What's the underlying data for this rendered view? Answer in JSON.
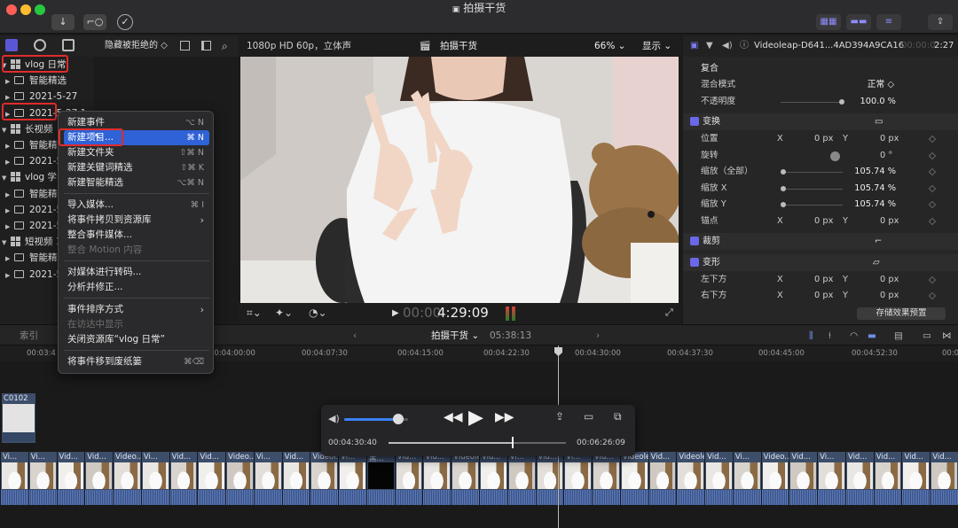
{
  "window": {
    "title": "拍摄干货",
    "traffic_lights": [
      "#ff5f57",
      "#febc2e",
      "#28c840"
    ],
    "toolbar_icons": [
      "import-icon",
      "keyword-icon",
      "check-icon"
    ],
    "right_icons": [
      "library-layout-icon",
      "timeline-layout-icon",
      "inspector-layout-icon",
      "share-icon"
    ]
  },
  "sidebar": {
    "filter_label": "隐藏被拒绝的",
    "items": [
      {
        "label": "vlog 日常",
        "type": "library",
        "expanded": true
      },
      {
        "label": "智能精选",
        "type": "folder",
        "expanded": false
      },
      {
        "label": "2021-5-27",
        "type": "event",
        "expanded": false
      },
      {
        "label": "2021-5-27 1",
        "type": "event",
        "expanded": false
      },
      {
        "label": "长视频",
        "type": "library",
        "expanded": true
      },
      {
        "label": "智能精选",
        "type": "folder",
        "expanded": false
      },
      {
        "label": "2021-5",
        "type": "event",
        "expanded": false
      },
      {
        "label": "vlog 学习",
        "type": "library",
        "expanded": true
      },
      {
        "label": "智能精选",
        "type": "folder",
        "expanded": false
      },
      {
        "label": "2021-5",
        "type": "event",
        "expanded": false
      },
      {
        "label": "2021-5",
        "type": "event",
        "expanded": false
      },
      {
        "label": "短视频 1",
        "type": "library",
        "expanded": true
      },
      {
        "label": "智能精选",
        "type": "folder",
        "expanded": false
      },
      {
        "label": "2021-5",
        "type": "event",
        "expanded": false
      }
    ]
  },
  "context_menu": {
    "items": [
      {
        "label": "新建事件",
        "shortcut": "⌥ N",
        "enabled": true
      },
      {
        "label": "新建项目...",
        "shortcut": "⌘ N",
        "enabled": true,
        "highlighted": true
      },
      {
        "label": "新建文件夹",
        "shortcut": "⇧⌘ N",
        "enabled": true
      },
      {
        "label": "新建关键词精选",
        "shortcut": "⇧⌘ K",
        "enabled": true
      },
      {
        "label": "新建智能精选",
        "shortcut": "⌥⌘ N",
        "enabled": true
      },
      {
        "separator": true
      },
      {
        "label": "导入媒体...",
        "shortcut": "⌘ I",
        "enabled": true
      },
      {
        "label": "将事件拷贝到资源库",
        "shortcut": "",
        "enabled": true,
        "submenu": true
      },
      {
        "label": "整合事件媒体...",
        "shortcut": "",
        "enabled": true
      },
      {
        "label": "整合 Motion 内容",
        "shortcut": "",
        "enabled": false
      },
      {
        "separator": true
      },
      {
        "label": "对媒体进行转码...",
        "shortcut": "",
        "enabled": true
      },
      {
        "label": "分析并修正...",
        "shortcut": "",
        "enabled": true
      },
      {
        "separator": true
      },
      {
        "label": "事件排序方式",
        "shortcut": "",
        "enabled": true,
        "submenu": true
      },
      {
        "label": "在访达中显示",
        "shortcut": "",
        "enabled": false
      },
      {
        "label": "关闭资源库“vlog 日常”",
        "shortcut": "",
        "enabled": true
      },
      {
        "separator": true
      },
      {
        "label": "将事件移到废纸篓",
        "shortcut": "⌘⌫",
        "enabled": true
      }
    ]
  },
  "viewer": {
    "format": "1080p HD 60p，立体声",
    "project_name": "拍摄干货",
    "zoom": "66%",
    "display_menu": "显示",
    "timecode_dim": "00:00",
    "timecode": "4:29:09"
  },
  "inspector": {
    "clip_name": "Videoleap-D641...4AD394A9CA16",
    "duration_dim": "00:00:0",
    "duration": "2:27",
    "sections": {
      "composite": "复合",
      "transform": "变换",
      "crop": "裁剪",
      "distort": "变形"
    },
    "composite_rows": [
      {
        "label": "混合模式",
        "value": "正常 ◇"
      },
      {
        "label": "不透明度",
        "value": "100.0 %"
      }
    ],
    "transform_rows": [
      {
        "label": "位置",
        "x": "0 px",
        "y": "0 px"
      },
      {
        "label": "旋转",
        "value": "0 °"
      },
      {
        "label": "缩放（全部）",
        "value": "105.74 %"
      },
      {
        "label": "缩放 X",
        "value": "105.74 %"
      },
      {
        "label": "缩放 Y",
        "value": "105.74 %"
      },
      {
        "label": "锚点",
        "x": "0 px",
        "y": "0 px"
      }
    ],
    "distort_rows": [
      {
        "label": "左下方",
        "x": "0 px",
        "y": "0 px"
      },
      {
        "label": "右下方",
        "x": "0 px",
        "y": "0 px"
      }
    ],
    "axis_x": "X",
    "axis_y": "Y",
    "save_preset": "存储效果预置"
  },
  "timeline": {
    "index_label": "索引",
    "project_name": "拍摄干货",
    "project_duration": "05:38:13",
    "ruler_ticks": [
      "00:03:4",
      "00:04:00:00",
      "00:04:07:30",
      "00:04:15:00",
      "00:04:22:30",
      "00:04:30:00",
      "00:04:37:30",
      "00:04:45:00",
      "00:04:52:30",
      "00:0"
    ],
    "connected_clip": "C0102",
    "clip_labels": [
      "Vi...",
      "Vi...",
      "Vid...",
      "Vid...",
      "Video...",
      "Vi...",
      "Vid...",
      "Vid...",
      "Video...",
      "Vi...",
      "Vid...",
      "Videol...",
      "Vi...",
      "黑...",
      "Vid...",
      "Vid...",
      "Videole...",
      "Vid...",
      "Vi...",
      "Vid...",
      "Vi...",
      "Vid...",
      "Videole...",
      "Vid...",
      "Videole...",
      "Vid...",
      "Vi...",
      "Video...",
      "Vid...",
      "Vi...",
      "Vid...",
      "Vid...",
      "Vid...",
      "Vid..."
    ]
  },
  "media_player": {
    "current_time": "00:04:30:40",
    "total_time": "00:06:26:09",
    "volume": 0.85,
    "progress": 0.7
  }
}
